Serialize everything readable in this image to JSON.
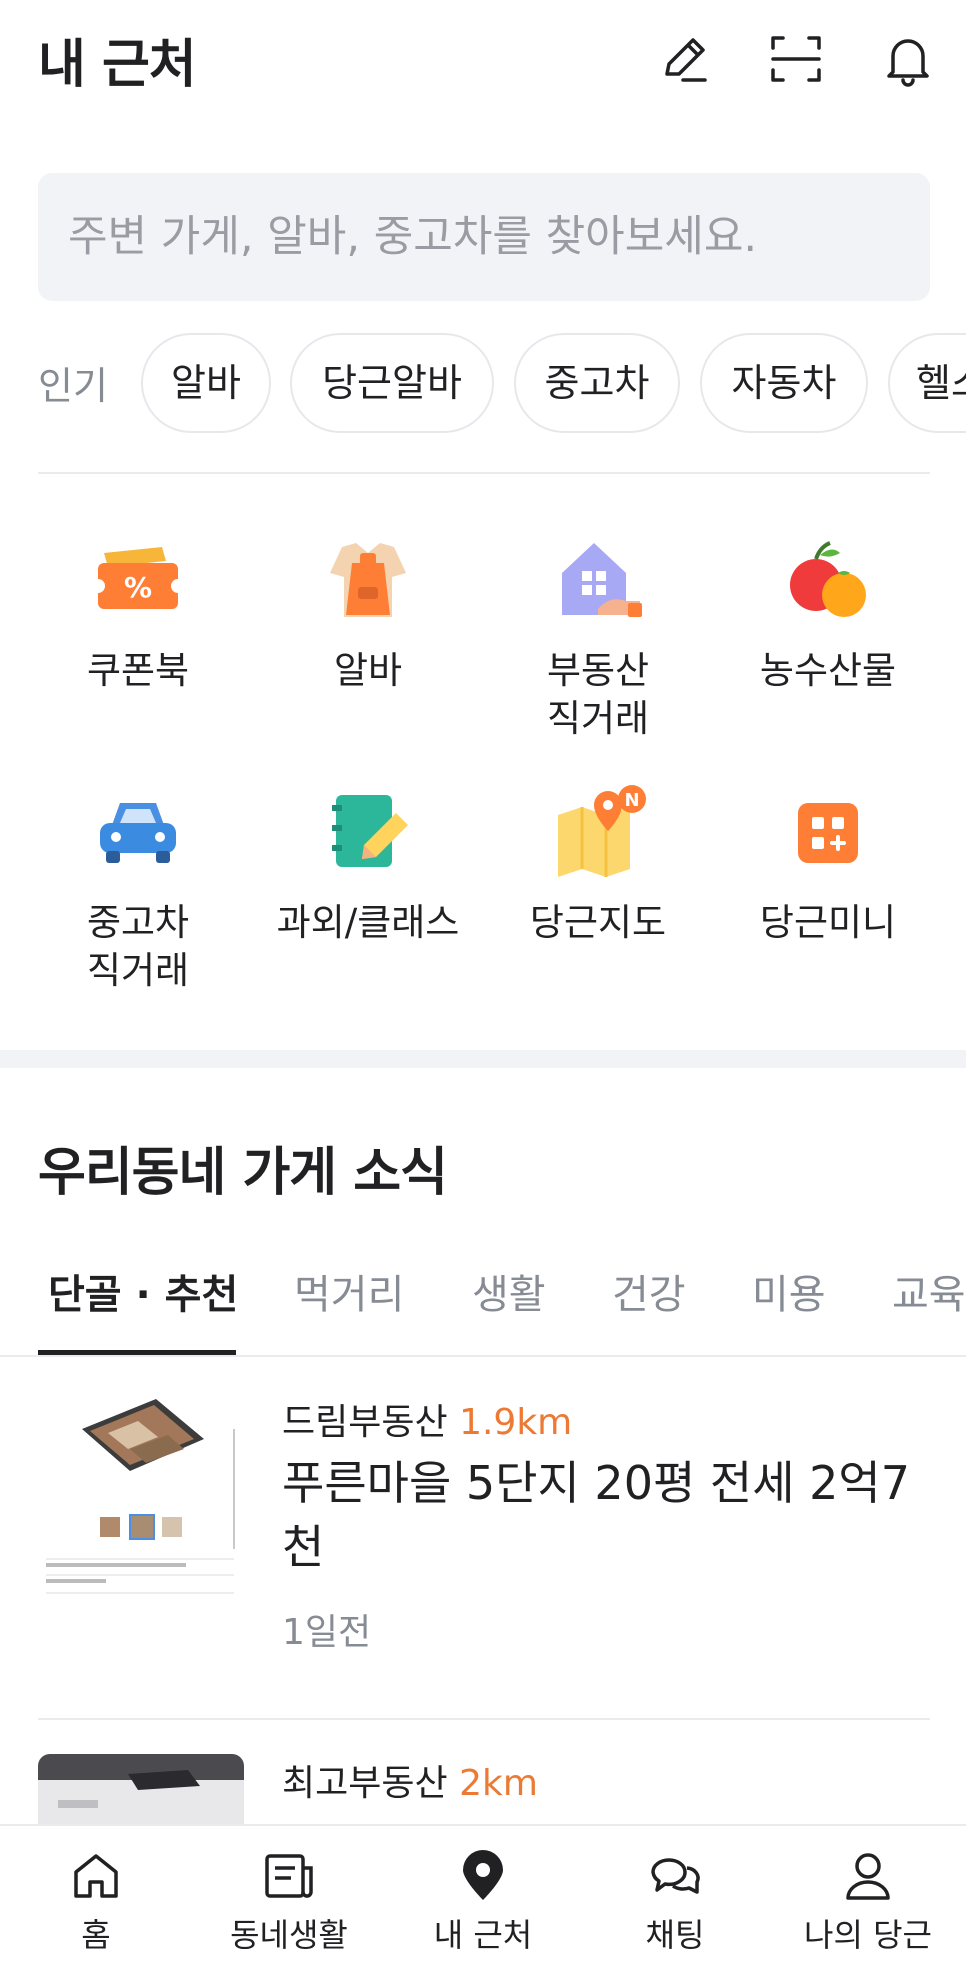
{
  "header": {
    "title": "내 근처",
    "icons": [
      "edit-icon",
      "scan-icon",
      "bell-icon"
    ]
  },
  "search": {
    "placeholder": "주변 가게, 알바, 중고차를 찾아보세요."
  },
  "popular": {
    "label": "인기",
    "chips": [
      "알바",
      "당근알바",
      "중고차",
      "자동차",
      "헬스"
    ]
  },
  "categories": [
    {
      "label": "쿠폰북",
      "icon": "coupon-icon"
    },
    {
      "label": "알바",
      "icon": "apron-icon"
    },
    {
      "label": "부동산\n직거래",
      "icon": "house-icon"
    },
    {
      "label": "농수산물",
      "icon": "fruit-icon"
    },
    {
      "label": "중고차\n직거래",
      "icon": "car-icon"
    },
    {
      "label": "과외/클래스",
      "icon": "notebook-icon"
    },
    {
      "label": "당근지도",
      "icon": "map-icon"
    },
    {
      "label": "당근미니",
      "icon": "mini-app-icon"
    }
  ],
  "map_badge": "N",
  "section": {
    "title": "우리동네 가게 소식",
    "tabs": [
      "단골 · 추천",
      "먹거리",
      "생활",
      "건강",
      "미용",
      "교육"
    ]
  },
  "feed": [
    {
      "store": "드림부동산",
      "distance": "1.9km",
      "title": "푸른마을 5단지 20평 전세 2억7천",
      "time": "1일전"
    },
    {
      "store": "최고부동산",
      "distance": "2km"
    }
  ],
  "bottom_nav": [
    {
      "label": "홈",
      "icon": "home-icon"
    },
    {
      "label": "동네생활",
      "icon": "news-icon"
    },
    {
      "label": "내 근처",
      "icon": "location-pin-icon"
    },
    {
      "label": "채팅",
      "icon": "chat-icon"
    },
    {
      "label": "나의 당근",
      "icon": "person-icon"
    }
  ],
  "colors": {
    "accent": "#ec7a34",
    "text": "#212124",
    "muted": "#868b94",
    "search_bg": "#f2f3f6"
  }
}
